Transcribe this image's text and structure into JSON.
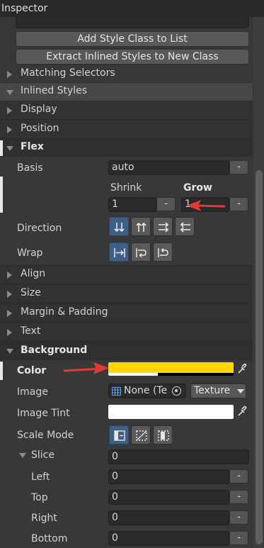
{
  "window": {
    "title": "Inspector"
  },
  "buttons": {
    "add_style_class": "Add Style Class to List",
    "extract_inlined": "Extract Inlined Styles to New Class"
  },
  "sections": {
    "matching_selectors": "Matching Selectors",
    "inlined_styles": "Inlined Styles",
    "display": "Display",
    "position": "Position",
    "flex": "Flex",
    "align": "Align",
    "size": "Size",
    "margin_padding": "Margin & Padding",
    "text": "Text",
    "background": "Background"
  },
  "flex": {
    "basis_label": "Basis",
    "basis_value": "auto",
    "shrink_label": "Shrink",
    "shrink_value": "1",
    "grow_label": "Grow",
    "grow_value": "1",
    "direction_label": "Direction",
    "wrap_label": "Wrap",
    "minus": "-"
  },
  "background": {
    "color_label": "Color",
    "color_value": "#FFD600",
    "image_label": "Image",
    "image_value": "None (Te",
    "image_type": "Texture",
    "image_tint_label": "Image Tint",
    "image_tint_value": "#FFFFFF",
    "scale_mode_label": "Scale Mode",
    "slice_label": "Slice",
    "slice_value": "0",
    "left_label": "Left",
    "left_value": "0",
    "top_label": "Top",
    "top_value": "0",
    "right_label": "Right",
    "right_value": "0",
    "bottom_label": "Bottom",
    "bottom_value": "0",
    "minus": "-"
  },
  "colors": {
    "annotation_arrow": "#E53935",
    "active_toggle": "#3E5F86"
  }
}
